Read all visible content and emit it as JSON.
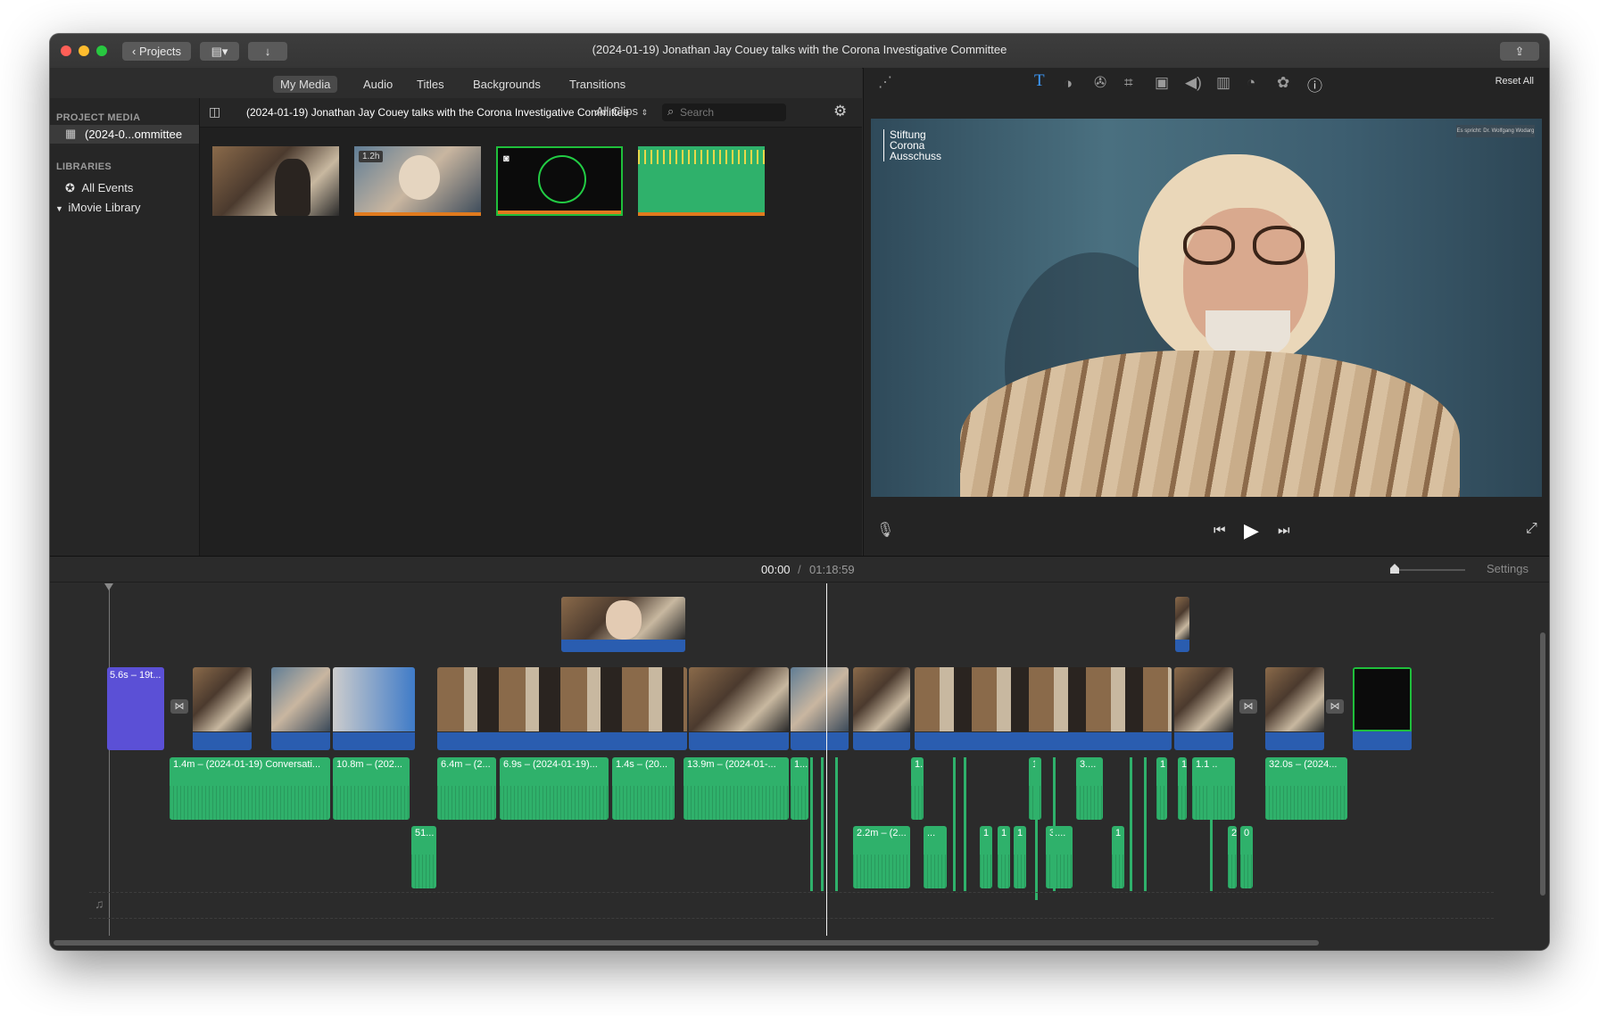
{
  "window": {
    "title": "(2024-01-19) Jonathan Jay Couey talks with the Corona Investigative Committee",
    "projects_button": "Projects"
  },
  "media_tabs": [
    "My Media",
    "Audio",
    "Titles",
    "Backgrounds",
    "Transitions"
  ],
  "sidebar": {
    "project_media_header": "PROJECT MEDIA",
    "project_item": "(2024-0...ommittee",
    "libraries_header": "LIBRARIES",
    "all_events": "All Events",
    "imovie_library": "iMovie Library"
  },
  "browser": {
    "event_title": "(2024-01-19) Jonathan Jay Couey talks with the Corona Investigative Committee",
    "filter": "All Clips",
    "search_placeholder": "Search",
    "thumb_badge": "1.2h"
  },
  "viewer": {
    "reset_all": "Reset All",
    "watermark_lines": [
      "Stiftung",
      "Corona",
      "Ausschuss"
    ],
    "caption_tag": "Es spricht: Dr. Wolfgang Wodarg"
  },
  "timeline": {
    "current_time": "00:00",
    "separator": "/",
    "duration": "01:18:59",
    "settings_label": "Settings",
    "title_clip_label": "5.6s – 19t...",
    "audio_labels": [
      "1.4m – (2024-01-19) Conversati...",
      "10.8m – (202...",
      "6.4m – (2...",
      "6.9s – (2024-01-19)...",
      "1.4s – (20...",
      "13.9m – (2024-01-...",
      "1...",
      "1.",
      "1",
      "3....",
      "1",
      "1",
      "1.1...",
      "32.0s – (2024..."
    ],
    "lower_audio_labels": [
      "51...",
      "2.2m – (2...",
      "...",
      "1",
      "1",
      "1",
      "3....",
      "1",
      "2",
      "0"
    ]
  }
}
